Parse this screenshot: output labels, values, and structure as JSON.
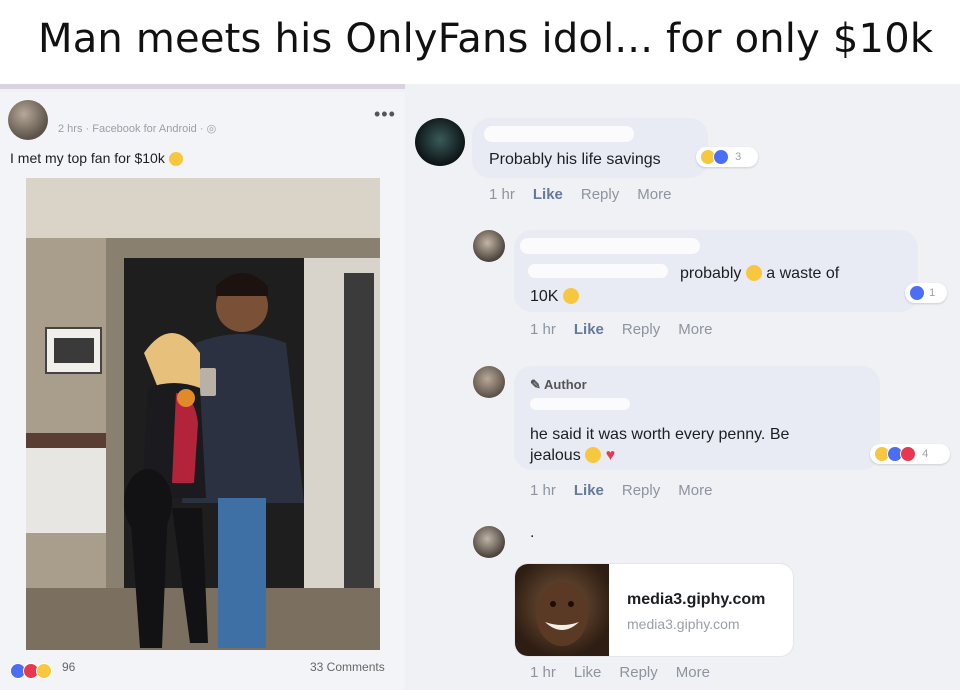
{
  "headline": "Man meets his OnlyFans idol... for only $10k",
  "post": {
    "meta": "2 hrs · Facebook for Android · ",
    "menu": "•••",
    "caption": "I met my top fan for $10k",
    "reaction_count": "96",
    "comments_count": "33 Comments"
  },
  "comments": [
    {
      "text": "Probably his life savings",
      "reaction_count": "3",
      "time": "1 hr",
      "like": "Like",
      "reply": "Reply",
      "more": "More"
    },
    {
      "text_line1_a": "probably",
      "text_line1_b": "a waste of",
      "text_line2": "10K",
      "reaction_count": "1",
      "time": "1 hr",
      "like": "Like",
      "reply": "Reply",
      "more": "More"
    },
    {
      "author_label": "Author",
      "text_line1": "he said it was worth every penny. Be",
      "text_line2": "jealous",
      "reaction_count": "4",
      "time": "1 hr",
      "like": "Like",
      "reply": "Reply",
      "more": "More"
    },
    {
      "name_fragment": ".",
      "link_title": "media3.giphy.com",
      "link_sub": "media3.giphy.com",
      "time": "1 hr",
      "like": "Like",
      "reply": "Reply",
      "more": "More"
    }
  ],
  "colors": {
    "like_blue": "#4c6ef5",
    "love_red": "#e8384f",
    "haha_yellow": "#f7c83f"
  }
}
